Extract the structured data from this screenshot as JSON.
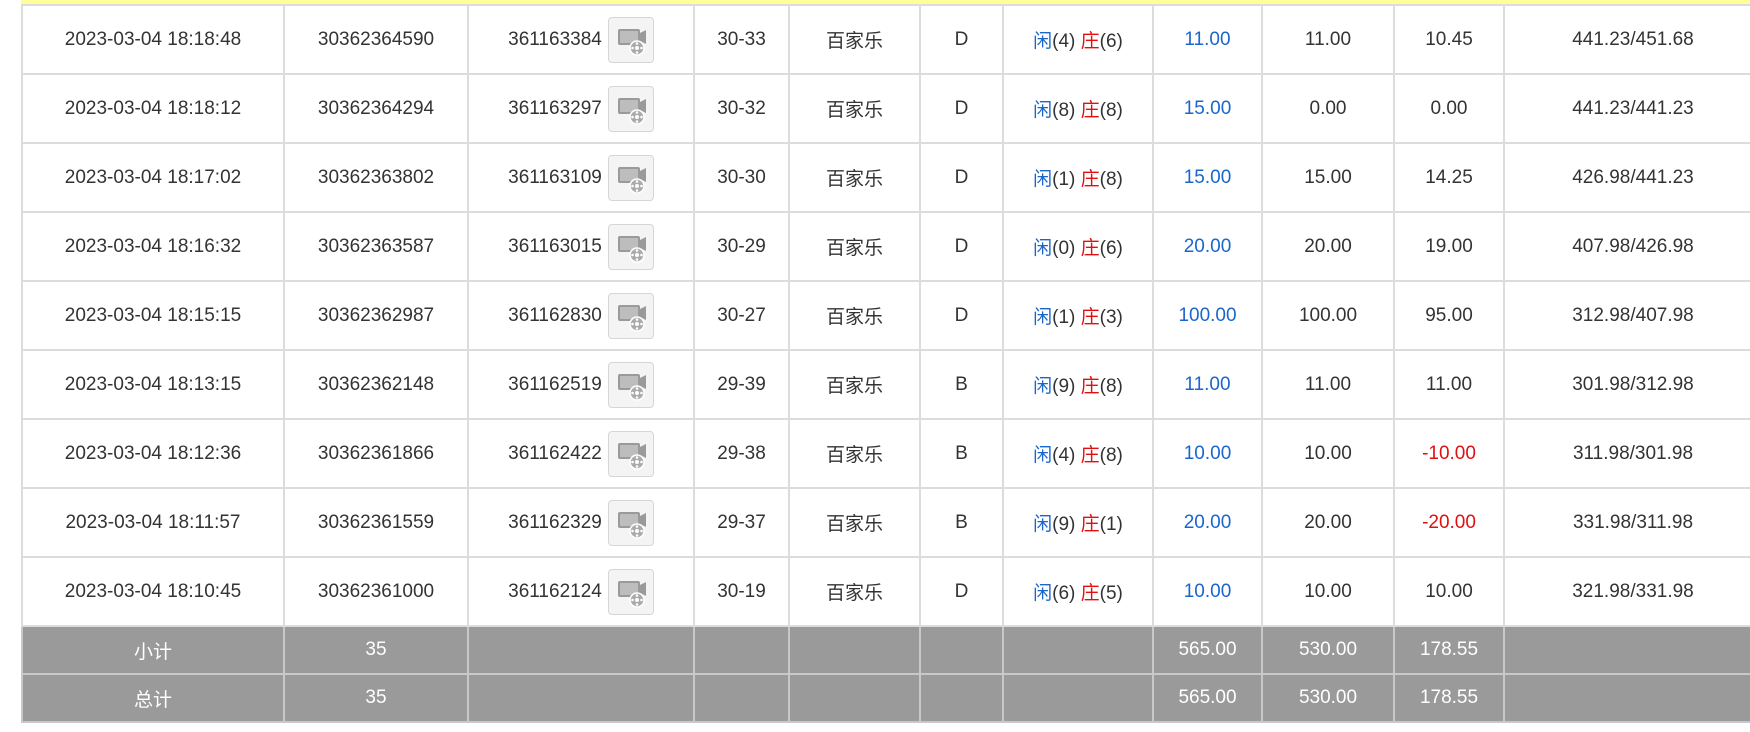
{
  "rows": [
    {
      "time": "2023-03-04 18:18:48",
      "order": "30362364590",
      "round": "361163384",
      "shoe": "30-33",
      "game": "百家乐",
      "table": "D",
      "player": "闲",
      "player_pts": "(4)",
      "banker": "庄",
      "banker_pts": "(6)",
      "bet": "11.00",
      "valid": "11.00",
      "winloss": "10.45",
      "balance": "441.23/451.68"
    },
    {
      "time": "2023-03-04 18:18:12",
      "order": "30362364294",
      "round": "361163297",
      "shoe": "30-32",
      "game": "百家乐",
      "table": "D",
      "player": "闲",
      "player_pts": "(8)",
      "banker": "庄",
      "banker_pts": "(8)",
      "bet": "15.00",
      "valid": "0.00",
      "winloss": "0.00",
      "balance": "441.23/441.23"
    },
    {
      "time": "2023-03-04 18:17:02",
      "order": "30362363802",
      "round": "361163109",
      "shoe": "30-30",
      "game": "百家乐",
      "table": "D",
      "player": "闲",
      "player_pts": "(1)",
      "banker": "庄",
      "banker_pts": "(8)",
      "bet": "15.00",
      "valid": "15.00",
      "winloss": "14.25",
      "balance": "426.98/441.23"
    },
    {
      "time": "2023-03-04 18:16:32",
      "order": "30362363587",
      "round": "361163015",
      "shoe": "30-29",
      "game": "百家乐",
      "table": "D",
      "player": "闲",
      "player_pts": "(0)",
      "banker": "庄",
      "banker_pts": "(6)",
      "bet": "20.00",
      "valid": "20.00",
      "winloss": "19.00",
      "balance": "407.98/426.98"
    },
    {
      "time": "2023-03-04 18:15:15",
      "order": "30362362987",
      "round": "361162830",
      "shoe": "30-27",
      "game": "百家乐",
      "table": "D",
      "player": "闲",
      "player_pts": "(1)",
      "banker": "庄",
      "banker_pts": "(3)",
      "bet": "100.00",
      "valid": "100.00",
      "winloss": "95.00",
      "balance": "312.98/407.98"
    },
    {
      "time": "2023-03-04 18:13:15",
      "order": "30362362148",
      "round": "361162519",
      "shoe": "29-39",
      "game": "百家乐",
      "table": "B",
      "player": "闲",
      "player_pts": "(9)",
      "banker": "庄",
      "banker_pts": "(8)",
      "bet": "11.00",
      "valid": "11.00",
      "winloss": "11.00",
      "balance": "301.98/312.98"
    },
    {
      "time": "2023-03-04 18:12:36",
      "order": "30362361866",
      "round": "361162422",
      "shoe": "29-38",
      "game": "百家乐",
      "table": "B",
      "player": "闲",
      "player_pts": "(4)",
      "banker": "庄",
      "banker_pts": "(8)",
      "bet": "10.00",
      "valid": "10.00",
      "winloss": "-10.00",
      "balance": "311.98/301.98"
    },
    {
      "time": "2023-03-04 18:11:57",
      "order": "30362361559",
      "round": "361162329",
      "shoe": "29-37",
      "game": "百家乐",
      "table": "B",
      "player": "闲",
      "player_pts": "(9)",
      "banker": "庄",
      "banker_pts": "(1)",
      "bet": "20.00",
      "valid": "20.00",
      "winloss": "-20.00",
      "balance": "331.98/311.98"
    },
    {
      "time": "2023-03-04 18:10:45",
      "order": "30362361000",
      "round": "361162124",
      "shoe": "30-19",
      "game": "百家乐",
      "table": "D",
      "player": "闲",
      "player_pts": "(6)",
      "banker": "庄",
      "banker_pts": "(5)",
      "bet": "10.00",
      "valid": "10.00",
      "winloss": "10.00",
      "balance": "321.98/331.98"
    }
  ],
  "subtotal": {
    "label": "小计",
    "count": "35",
    "bet": "565.00",
    "valid": "530.00",
    "winloss": "178.55"
  },
  "total": {
    "label": "总计",
    "count": "35",
    "bet": "565.00",
    "valid": "530.00",
    "winloss": "178.55"
  },
  "icons": {
    "replay": "video-replay-icon"
  },
  "colors": {
    "player": "#1a66cc",
    "banker": "#e01010",
    "negative": "#e01010",
    "bet": "#1a66cc",
    "summary_bg": "#9a9a9a",
    "header_strip": "#ffff99"
  }
}
